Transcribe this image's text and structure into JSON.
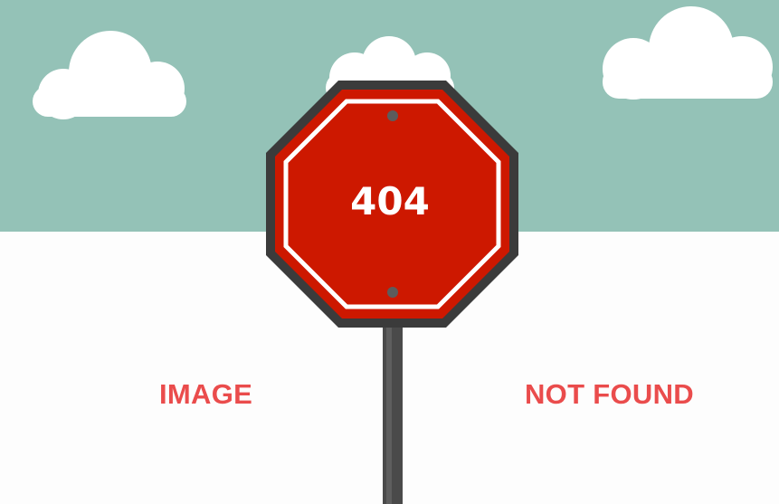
{
  "sign": {
    "code": "404"
  },
  "captions": {
    "left": "IMAGE",
    "right": "NOT FOUND"
  },
  "colors": {
    "sky": "#94c2b7",
    "ground": "#fdfdfd",
    "sign_red": "#cd1800",
    "sign_border": "#3b3b3b",
    "caption": "#ea4c4c",
    "pole": "#4a4a4a"
  }
}
